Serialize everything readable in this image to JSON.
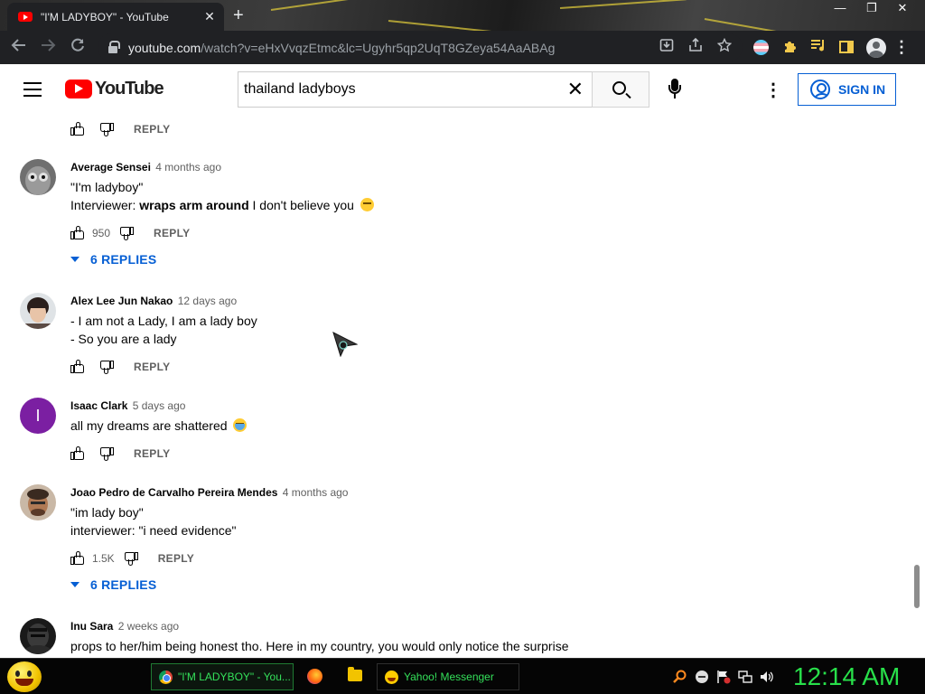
{
  "browser": {
    "tab_title": "\"I'M LADYBOY\" - YouTube",
    "tab_close": "✕",
    "new_tab": "+",
    "url_host": "youtube.com",
    "url_path": "/watch?v=eHxVvqzEtmc&lc=Ugyhr5qp2UqT8GZeya54AaABAg",
    "window_controls": [
      "—",
      "❐",
      "✕"
    ]
  },
  "youtube": {
    "logo_text": "YouTube",
    "search_value": "thailand ladyboys",
    "search_clear": "✕",
    "sign_in_label": "SIGN IN"
  },
  "comments": {
    "prev_reply_label": "REPLY",
    "items": [
      {
        "author": "Average Sensei",
        "time": "4 months ago",
        "line1": "\"I'm ladyboy\"",
        "line2_prefix": "Interviewer: ",
        "line2_bold": "wraps arm around",
        "line2_suffix": " I don't believe you",
        "likes": "950",
        "reply_label": "REPLY",
        "replies_label": "6 REPLIES",
        "avatar_color": "#8a8a8a"
      },
      {
        "author": "Alex Lee Jun Nakao",
        "time": "12 days ago",
        "line1": "- I am not a Lady, I am a lady boy",
        "line2": "- So you are a lady",
        "reply_label": "REPLY",
        "avatar_color": "#4a3a36"
      },
      {
        "author": "Isaac Clark",
        "time": "5 days ago",
        "avatar_letter": "I",
        "line1": "all my dreams are shattered",
        "reply_label": "REPLY",
        "avatar_color": "#7b1fa2"
      },
      {
        "author": "Joao Pedro de Carvalho Pereira Mendes",
        "time": "4 months ago",
        "line1": "\"im lady boy\"",
        "line2": "interviewer: \"i need evidence\"",
        "likes": "1.5K",
        "reply_label": "REPLY",
        "replies_label": "6 REPLIES",
        "avatar_color": "#9c6b4a"
      },
      {
        "author": "Inu Sara",
        "time": "2 weeks ago",
        "line1": "props to her/him being honest tho. Here in my country, you would only notice the surprise",
        "avatar_color": "#222222"
      }
    ]
  },
  "taskbar": {
    "chrome_task": "\"I'M LADYBOY\" - You...",
    "messenger_task": "Yahoo! Messenger",
    "clock": "12:14 AM"
  },
  "colors": {
    "accent_blue": "#065fd4",
    "youtube_red": "#ff0000",
    "taskbar_text": "#28e04a"
  }
}
